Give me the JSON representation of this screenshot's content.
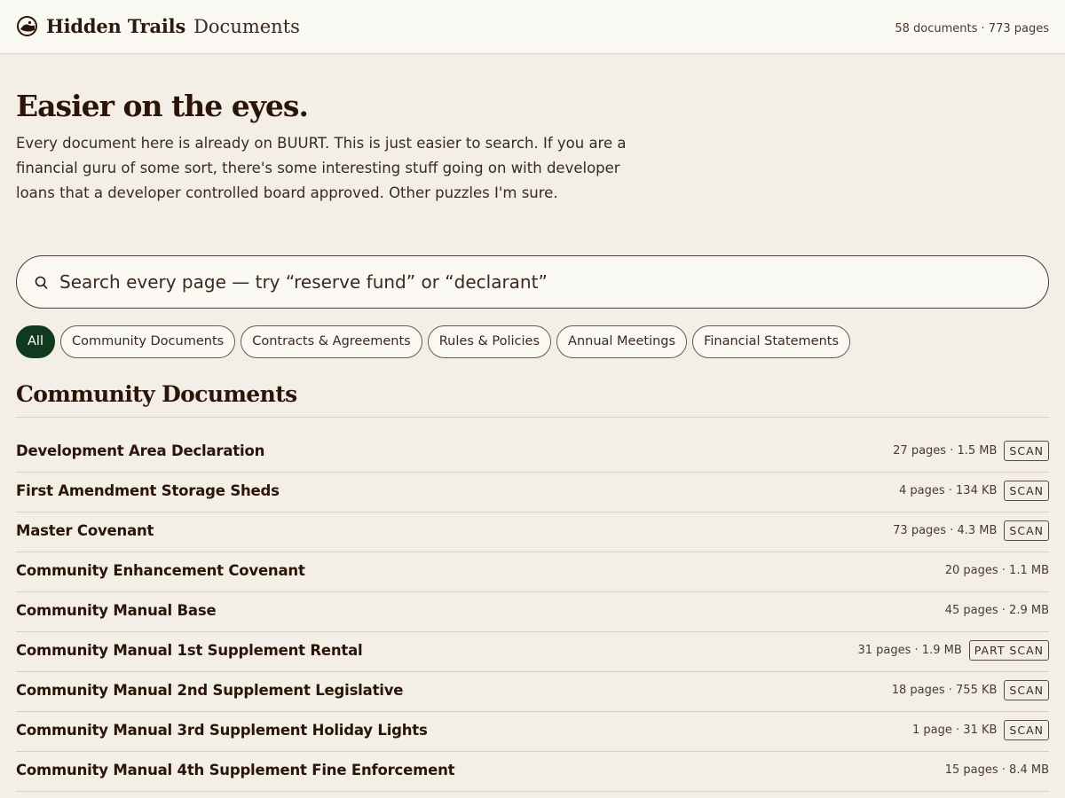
{
  "header": {
    "brand": "Hidden Trails",
    "section": "Documents",
    "stats": "58 documents · 773 pages"
  },
  "hero": {
    "title": "Easier on the eyes.",
    "description": "Every document here is already on BUURT. This is just easier to search. If you are a financial guru of some sort, there's some interesting stuff going on with developer loans that a developer controlled board approved. Other puzzles I'm sure."
  },
  "search": {
    "placeholder": "Search every page — try “reserve fund” or “declarant”",
    "value": ""
  },
  "filters": [
    {
      "label": "All",
      "active": true
    },
    {
      "label": "Community Documents",
      "active": false
    },
    {
      "label": "Contracts & Agreements",
      "active": false
    },
    {
      "label": "Rules & Policies",
      "active": false
    },
    {
      "label": "Annual Meetings",
      "active": false
    },
    {
      "label": "Financial Statements",
      "active": false
    }
  ],
  "section": {
    "title": "Community Documents"
  },
  "documents": [
    {
      "title": "Development Area Declaration",
      "meta": "27 pages · 1.5 MB",
      "tag": "SCAN"
    },
    {
      "title": "First Amendment Storage Sheds",
      "meta": "4 pages · 134 KB",
      "tag": "SCAN"
    },
    {
      "title": "Master Covenant",
      "meta": "73 pages · 4.3 MB",
      "tag": "SCAN"
    },
    {
      "title": "Community Enhancement Covenant",
      "meta": "20 pages · 1.1 MB",
      "tag": ""
    },
    {
      "title": "Community Manual Base",
      "meta": "45 pages · 2.9 MB",
      "tag": ""
    },
    {
      "title": "Community Manual 1st Supplement Rental",
      "meta": "31 pages · 1.9 MB",
      "tag": "PART SCAN"
    },
    {
      "title": "Community Manual 2nd Supplement Legislative",
      "meta": "18 pages · 755 KB",
      "tag": "SCAN"
    },
    {
      "title": "Community Manual 3rd Supplement Holiday Lights",
      "meta": "1 page · 31 KB",
      "tag": "SCAN"
    },
    {
      "title": "Community Manual 4th Supplement Fine Enforcement",
      "meta": "15 pages · 8.4 MB",
      "tag": ""
    }
  ]
}
